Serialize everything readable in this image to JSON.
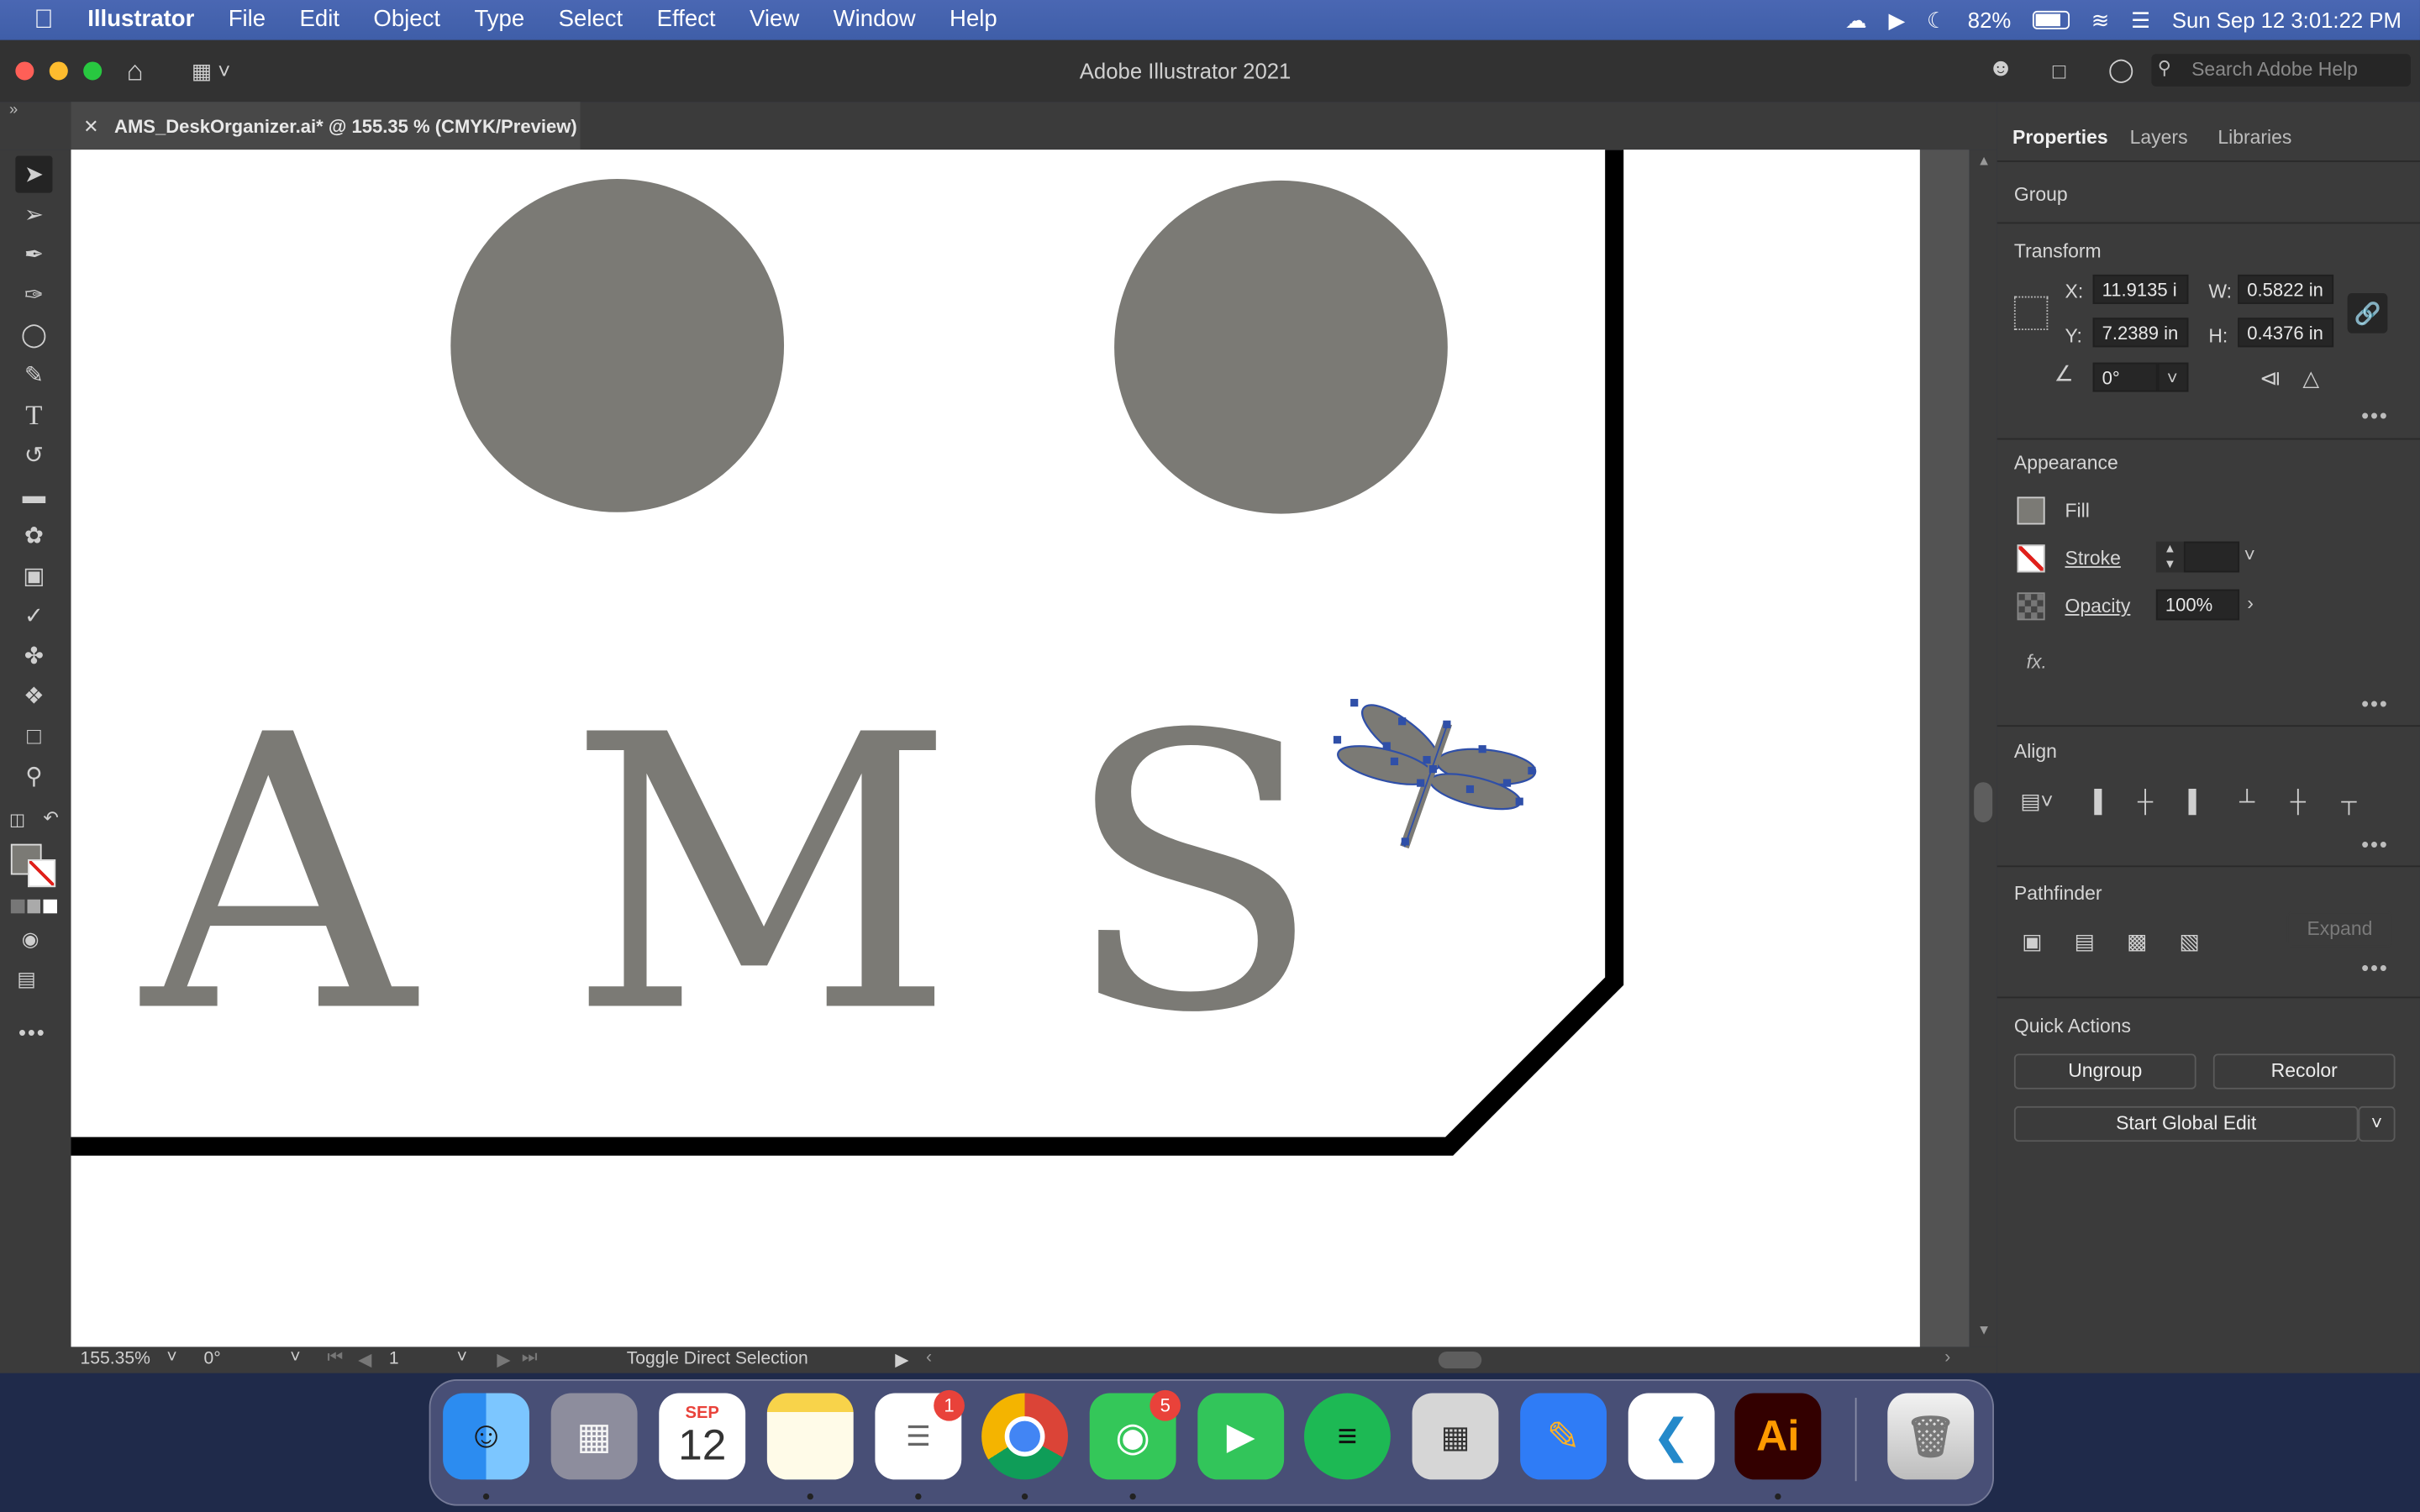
{
  "menubar": {
    "app_name": "Illustrator",
    "menus": [
      "File",
      "Edit",
      "Object",
      "Type",
      "Select",
      "Effect",
      "View",
      "Window",
      "Help"
    ],
    "battery": "82%",
    "datetime": "Sun Sep 12  3:01:22 PM"
  },
  "titlebar": {
    "title": "Adobe Illustrator 2021",
    "search_placeholder": "Search Adobe Help"
  },
  "document": {
    "tab_label": "AMS_DeskOrganizer.ai* @ 155.35 % (CMYK/Preview)",
    "artwork_letters": [
      "A",
      "M",
      "S"
    ]
  },
  "statusbar": {
    "zoom": "155.35%",
    "rotation": "0°",
    "artboard_number": "1",
    "status_text": "Toggle Direct Selection"
  },
  "panel": {
    "tabs": [
      "Properties",
      "Layers",
      "Libraries"
    ],
    "selection_type": "Group",
    "transform": {
      "heading": "Transform",
      "x_label": "X:",
      "x_value": "11.9135 i",
      "y_label": "Y:",
      "y_value": "7.2389 in",
      "w_label": "W:",
      "w_value": "0.5822 in",
      "h_label": "H:",
      "h_value": "0.4376 in",
      "angle_value": "0°"
    },
    "appearance": {
      "heading": "Appearance",
      "fill_label": "Fill",
      "stroke_label": "Stroke",
      "opacity_label": "Opacity",
      "opacity_value": "100%",
      "fx_label": "fx."
    },
    "align": {
      "heading": "Align"
    },
    "pathfinder": {
      "heading": "Pathfinder",
      "expand_label": "Expand"
    },
    "quick_actions": {
      "heading": "Quick Actions",
      "ungroup_label": "Ungroup",
      "recolor_label": "Recolor",
      "global_edit_label": "Start Global Edit"
    }
  },
  "dock": {
    "calendar_month": "SEP",
    "calendar_day": "12",
    "reminders_badge": "1",
    "messages_badge": "5",
    "illustrator_label": "Ai"
  },
  "colors": {
    "artwork_gray": "#7b7a75",
    "selection_blue": "#2f4fa8",
    "menubar_blue": "#4364b0",
    "illustrator_orange": "#ff9a00"
  }
}
